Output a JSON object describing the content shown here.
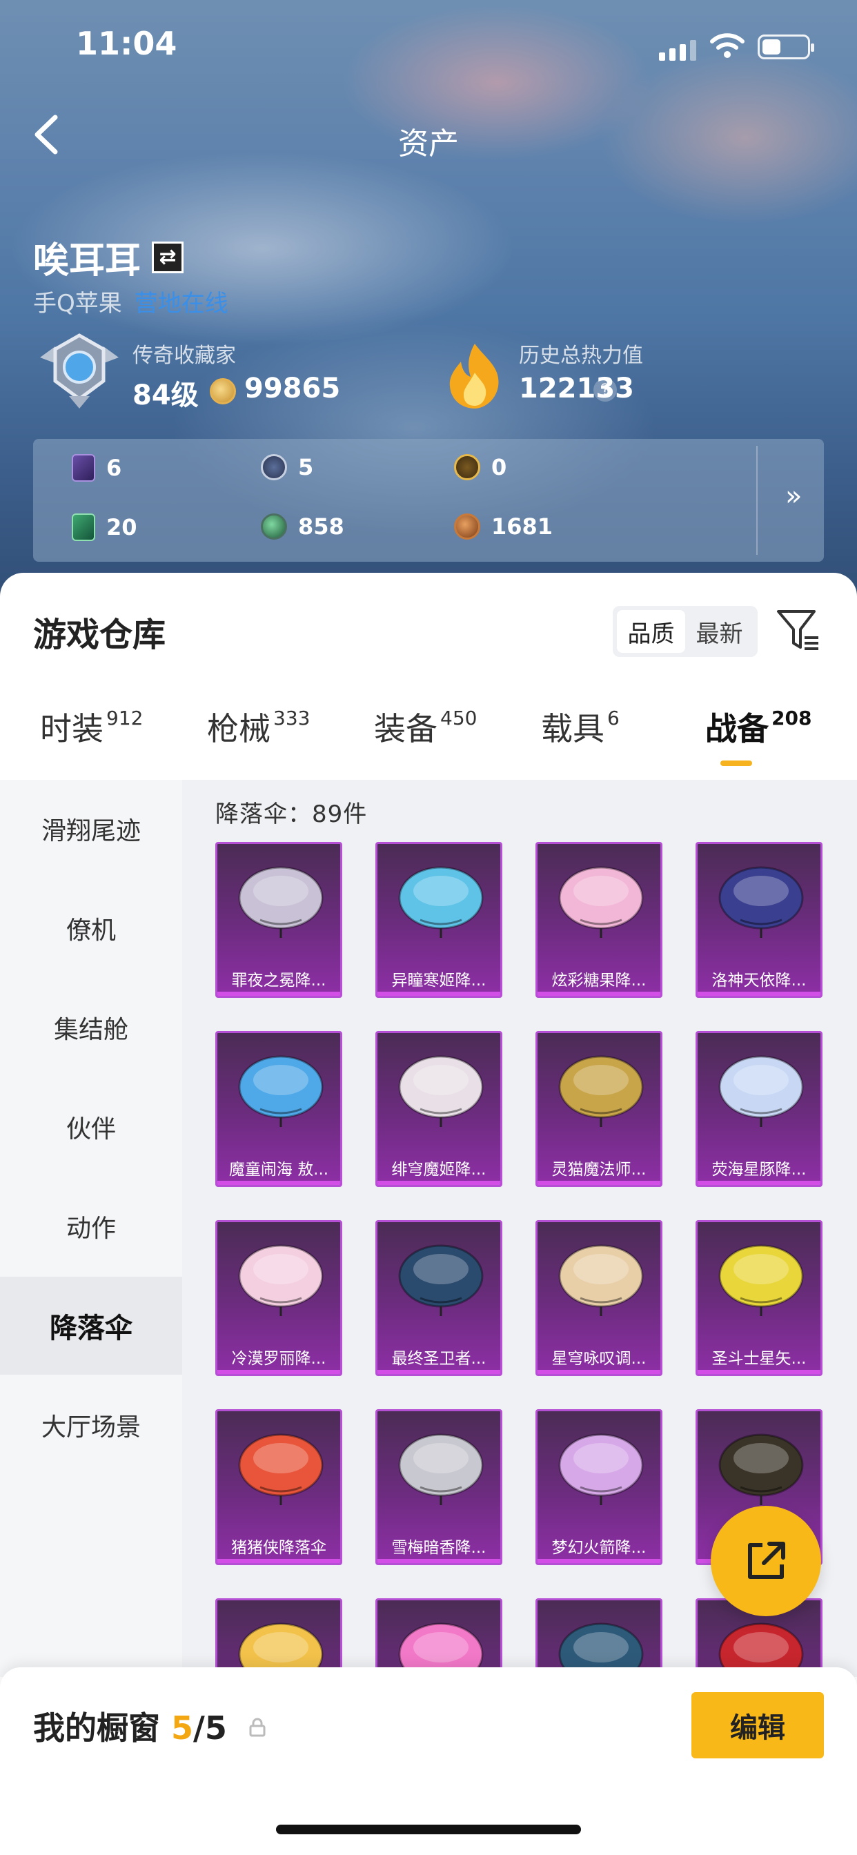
{
  "status_bar": {
    "time": "11:04"
  },
  "header": {
    "title": "资产"
  },
  "profile": {
    "name": "唉耳耳",
    "platform": "手Q苹果",
    "online_status": "营地在线",
    "collector_label": "传奇收藏家",
    "level": "84级",
    "coins": "99865",
    "heat_label": "历史总热力值",
    "heat_value": "122133",
    "heat_help": "?"
  },
  "stats": [
    {
      "icon": "purple-card-icon",
      "value": "6"
    },
    {
      "icon": "silver-coin-icon",
      "value": "5"
    },
    {
      "icon": "gold-coin-icon",
      "value": "0"
    },
    {
      "icon": "green-card-icon",
      "value": "20"
    },
    {
      "icon": "green-orb-icon",
      "value": "858"
    },
    {
      "icon": "bronze-coin-icon",
      "value": "1681"
    }
  ],
  "stats_more": "»",
  "warehouse": {
    "title": "游戏仓库",
    "sort_options": [
      "品质",
      "最新"
    ],
    "sort_selected": "品质"
  },
  "tabs": [
    {
      "label": "时装",
      "count": "912"
    },
    {
      "label": "枪械",
      "count": "333"
    },
    {
      "label": "装备",
      "count": "450"
    },
    {
      "label": "载具",
      "count": "6"
    },
    {
      "label": "战备",
      "count": "208",
      "active": true
    }
  ],
  "sidebar": [
    {
      "label": "滑翔尾迹"
    },
    {
      "label": "僚机"
    },
    {
      "label": "集结舱"
    },
    {
      "label": "伙伴"
    },
    {
      "label": "动作"
    },
    {
      "label": "降落伞",
      "active": true
    },
    {
      "label": "大厅场景"
    }
  ],
  "grid": {
    "count_label": "降落伞：89件",
    "items": [
      {
        "name": "罪夜之冕降...",
        "color": "#c9c2d6"
      },
      {
        "name": "异瞳寒姬降...",
        "color": "#5fc3e8"
      },
      {
        "name": "炫彩糖果降...",
        "color": "#f2b7d6"
      },
      {
        "name": "洛神天依降...",
        "color": "#3a3f8f"
      },
      {
        "name": "魔童闹海 敖...",
        "color": "#4fa8e8"
      },
      {
        "name": "绯穹魔姬降...",
        "color": "#e8e0e6"
      },
      {
        "name": "灵猫魔法师...",
        "color": "#c9a54a"
      },
      {
        "name": "荧海星豚降...",
        "color": "#c8d8f4"
      },
      {
        "name": "冷漠罗丽降...",
        "color": "#f4cfe0"
      },
      {
        "name": "最终圣卫者...",
        "color": "#2a4a6e"
      },
      {
        "name": "星穹咏叹调...",
        "color": "#e8cfa8"
      },
      {
        "name": "圣斗士星矢...",
        "color": "#e8d63a"
      },
      {
        "name": "猪猪侠降落伞",
        "color": "#e8553a"
      },
      {
        "name": "雪梅暗香降...",
        "color": "#c8c8d0"
      },
      {
        "name": "梦幻火箭降...",
        "color": "#d6a8e8"
      },
      {
        "name": "",
        "color": "#3a3428"
      },
      {
        "name": "",
        "color": "#f2c24a"
      },
      {
        "name": "",
        "color": "#f278c8"
      },
      {
        "name": "",
        "color": "#2e5a7a"
      },
      {
        "name": "",
        "color": "#c8262e"
      }
    ]
  },
  "showcase": {
    "label": "我的橱窗",
    "used": "5",
    "total": "/5",
    "edit_label": "编辑"
  },
  "colors": {
    "accent": "#f8b818",
    "rarity_purple": "#b54fd4"
  }
}
